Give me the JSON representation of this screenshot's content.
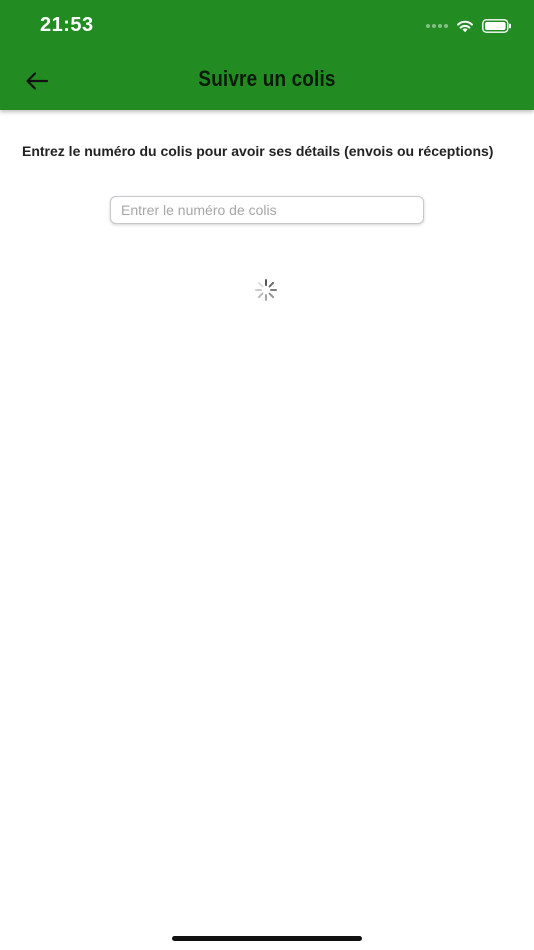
{
  "status_bar": {
    "time": "21:53",
    "icons": [
      "signal-dots-icon",
      "wifi-icon",
      "battery-icon"
    ]
  },
  "header": {
    "title": "Suivre un colis",
    "back_icon": "arrow-left-icon",
    "background_color": "#228b22"
  },
  "main": {
    "instruction": "Entrez le numéro du colis pour avoir ses détails (envois ou réceptions)",
    "tracking_input": {
      "value": "",
      "placeholder": "Entrer le numéro de colis"
    },
    "loading_indicator": "spinner-icon"
  }
}
